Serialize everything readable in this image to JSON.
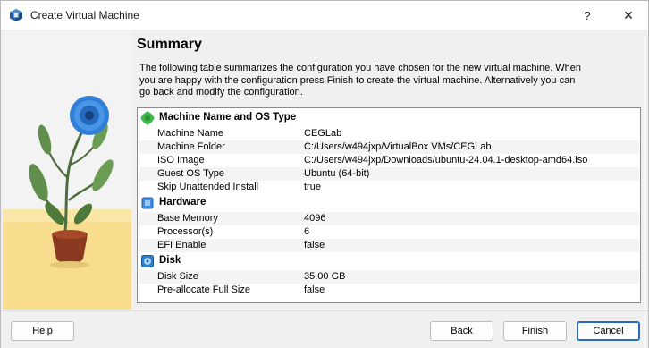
{
  "window": {
    "title": "Create Virtual Machine",
    "help_glyph": "?",
    "close_glyph": "✕",
    "accent": "#2b6ab8"
  },
  "summary": {
    "title": "Summary",
    "description": "The following table summarizes the configuration you have chosen for the new virtual machine. When you are happy with the configuration press Finish to create the virtual machine. Alternatively you can go back and modify the configuration."
  },
  "sections": [
    {
      "title": "Machine Name and OS Type",
      "icon": "puzzle-icon",
      "rows": [
        {
          "key": "Machine Name",
          "value": "CEGLab"
        },
        {
          "key": "Machine Folder",
          "value": "C:/Users/w494jxp/VirtualBox VMs/CEGLab"
        },
        {
          "key": "ISO Image",
          "value": "C:/Users/w494jxp/Downloads/ubuntu-24.04.1-desktop-amd64.iso"
        },
        {
          "key": "Guest OS Type",
          "value": "Ubuntu (64-bit)"
        },
        {
          "key": "Skip Unattended Install",
          "value": "true"
        }
      ]
    },
    {
      "title": "Hardware",
      "icon": "chip-icon",
      "rows": [
        {
          "key": "Base Memory",
          "value": "4096"
        },
        {
          "key": "Processor(s)",
          "value": "6"
        },
        {
          "key": "EFI Enable",
          "value": "false"
        }
      ]
    },
    {
      "title": "Disk",
      "icon": "disk-icon",
      "rows": [
        {
          "key": "Disk Size",
          "value": "35.00 GB"
        },
        {
          "key": "Pre-allocate Full Size",
          "value": "false"
        }
      ]
    }
  ],
  "buttons": {
    "help": "Help",
    "back": "Back",
    "finish": "Finish",
    "cancel": "Cancel"
  }
}
